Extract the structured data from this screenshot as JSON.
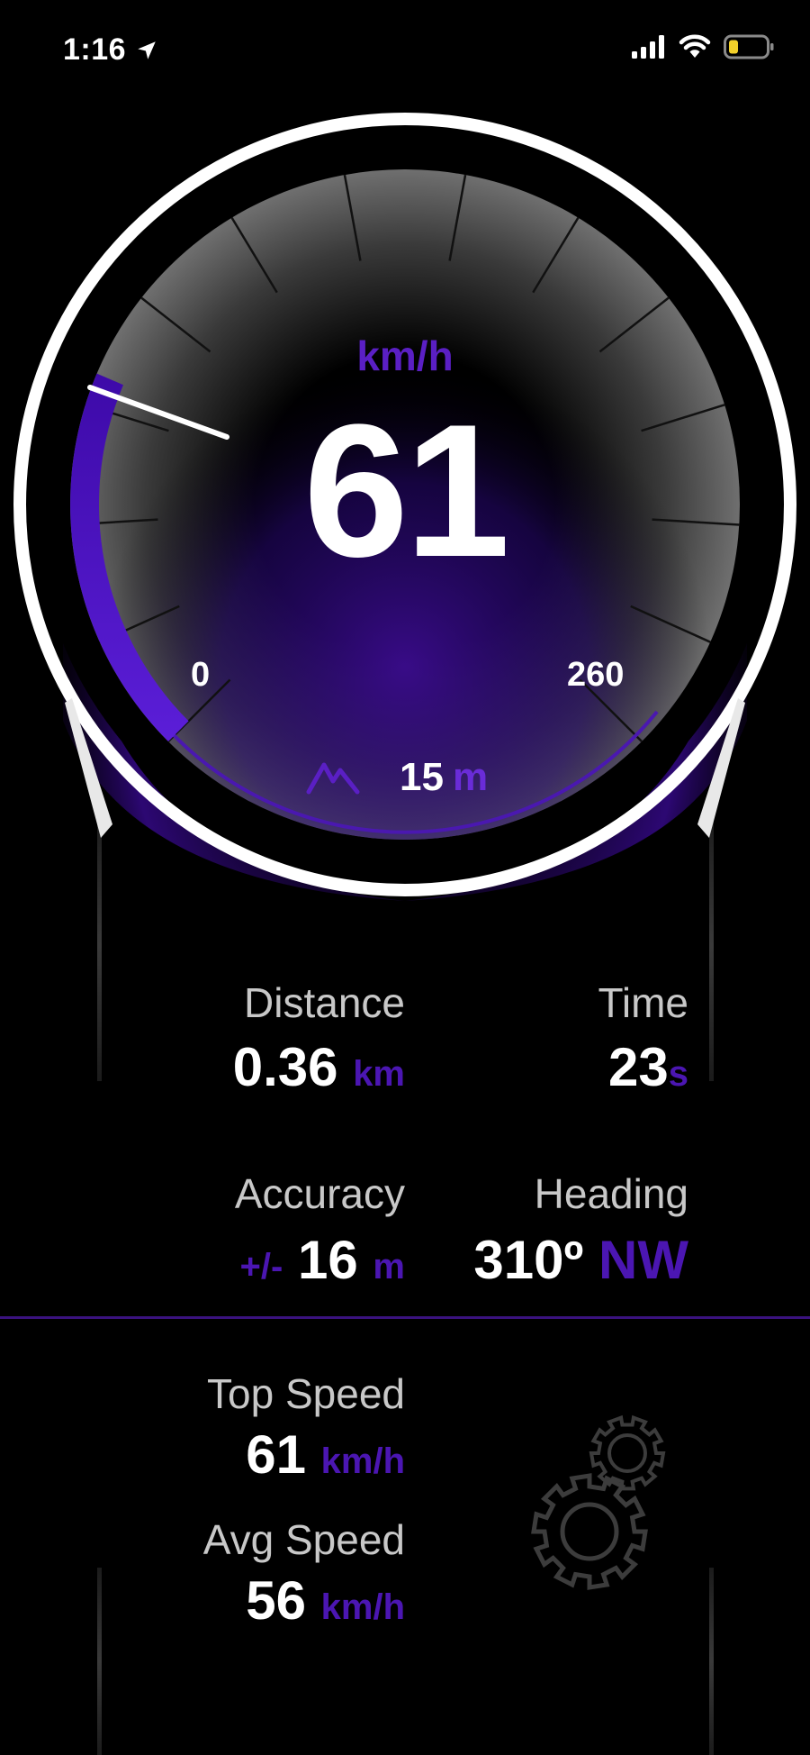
{
  "status_bar": {
    "time": "1:16"
  },
  "speedometer": {
    "unit": "km/h",
    "speed": "61",
    "scale_min": "0",
    "scale_max": "260",
    "altitude_value": "15",
    "altitude_unit": "m",
    "accent_color": "#5a1fc4"
  },
  "stats": {
    "distance": {
      "label": "Distance",
      "value": "0.36",
      "unit": "km"
    },
    "time": {
      "label": "Time",
      "value": "23",
      "unit": "s"
    },
    "accuracy": {
      "label": "Accuracy",
      "prefix": "+/-",
      "value": "16",
      "unit": "m"
    },
    "heading": {
      "label": "Heading",
      "value": "310º",
      "direction": "NW"
    }
  },
  "summary": {
    "top_speed": {
      "label": "Top Speed",
      "value": "61",
      "unit": "km/h"
    },
    "avg_speed": {
      "label": "Avg Speed",
      "value": "56",
      "unit": "km/h"
    }
  },
  "icons": {
    "settings": "gear-icon",
    "altitude": "mountain-icon",
    "location": "location-arrow-icon"
  }
}
